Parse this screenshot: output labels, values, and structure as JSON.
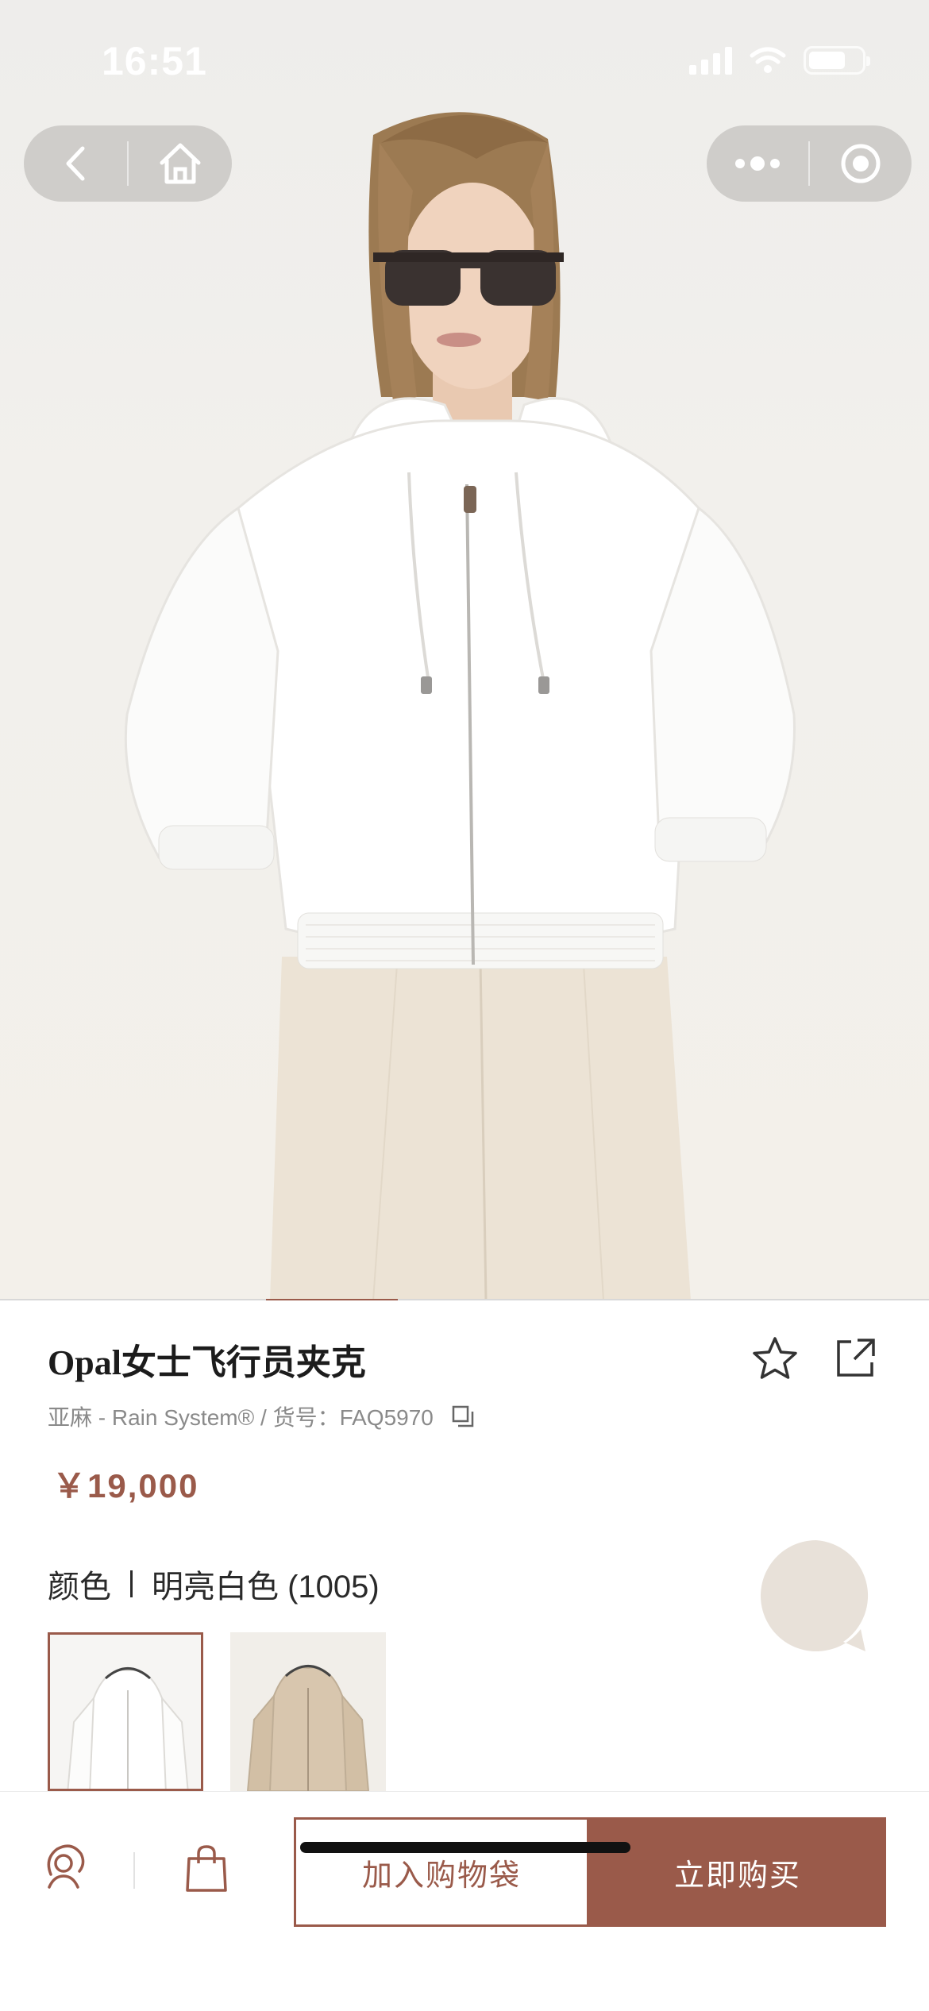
{
  "status_bar": {
    "time": "16:51"
  },
  "gallery": {
    "current_index_fraction_start": 0.286,
    "current_index_fraction_end": 0.428
  },
  "product": {
    "title": "Opal女士飞行员夹克",
    "meta": "亚麻 - Rain System® / 货号：FAQ5970",
    "price": "￥19,000"
  },
  "color": {
    "label": "颜色",
    "value": "明亮白色 (1005)",
    "swatches": [
      "white-jacket",
      "beige-jacket"
    ]
  },
  "actions": {
    "add_to_bag": "加入购物袋",
    "buy_now": "立即购买"
  },
  "colors": {
    "accent": "#9a5a4a",
    "jacket_white": "#ffffff",
    "trousers": "#ede5d8",
    "beige_jacket": "#d8c6ae"
  }
}
